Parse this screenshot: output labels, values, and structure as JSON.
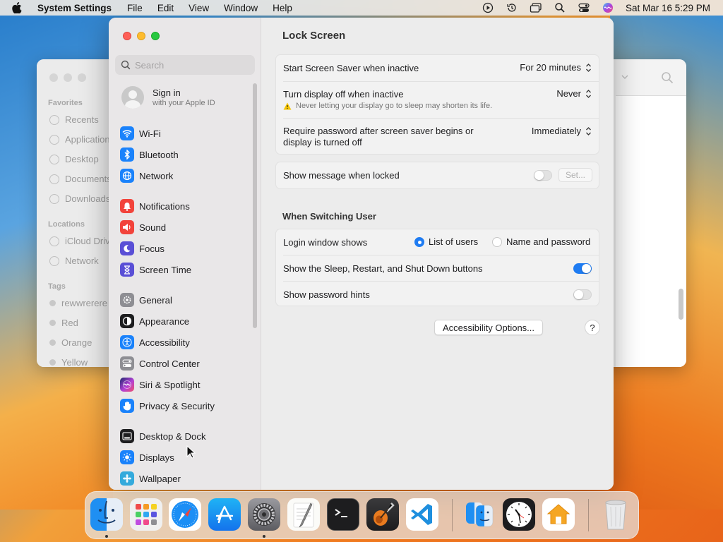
{
  "menubar": {
    "app_name": "System Settings",
    "items": [
      "File",
      "Edit",
      "View",
      "Window",
      "Help"
    ],
    "clock": "Sat Mar 16  5:29 PM"
  },
  "finder_bg": {
    "sections": [
      "Favorites",
      "Locations",
      "Tags"
    ],
    "favorites": [
      "Recents",
      "Applications",
      "Desktop",
      "Documents",
      "Downloads"
    ],
    "locations": [
      "iCloud Drive",
      "Network"
    ],
    "tags": [
      "rewwrerere",
      "Red",
      "Orange",
      "Yellow"
    ]
  },
  "sidebar": {
    "search_placeholder": "Search",
    "signin_title": "Sign in",
    "signin_sub": "with your Apple ID",
    "items": [
      {
        "label": "Wi-Fi",
        "icon": "wifi-icon",
        "color": "#1a82fb"
      },
      {
        "label": "Bluetooth",
        "icon": "bluetooth-icon",
        "color": "#1a82fb"
      },
      {
        "label": "Network",
        "icon": "globe-icon",
        "color": "#1a82fb"
      },
      {
        "label": "Notifications",
        "icon": "bell-icon",
        "color": "#f2433b"
      },
      {
        "label": "Sound",
        "icon": "speaker-icon",
        "color": "#f2433b"
      },
      {
        "label": "Focus",
        "icon": "moon-icon",
        "color": "#5a4fd6"
      },
      {
        "label": "Screen Time",
        "icon": "hourglass-icon",
        "color": "#5a4fd6"
      },
      {
        "label": "General",
        "icon": "gear-icon",
        "color": "#8e8e93"
      },
      {
        "label": "Appearance",
        "icon": "appearance-icon",
        "color": "#1d1d1f"
      },
      {
        "label": "Accessibility",
        "icon": "accessibility-icon",
        "color": "#1a82fb"
      },
      {
        "label": "Control Center",
        "icon": "control-center-icon",
        "color": "#8e8e93"
      },
      {
        "label": "Siri & Spotlight",
        "icon": "siri-icon",
        "color": "#b340d6"
      },
      {
        "label": "Privacy & Security",
        "icon": "hand-icon",
        "color": "#1a82fb"
      },
      {
        "label": "Desktop & Dock",
        "icon": "dock-icon",
        "color": "#1d1d1f"
      },
      {
        "label": "Displays",
        "icon": "sun-icon",
        "color": "#1a82fb"
      },
      {
        "label": "Wallpaper",
        "icon": "wallpaper-icon",
        "color": "#34aadc"
      }
    ]
  },
  "main": {
    "title": "Lock Screen",
    "screensaver_label": "Start Screen Saver when inactive",
    "screensaver_value": "For 20 minutes",
    "display_off_label": "Turn display off when inactive",
    "display_off_value": "Never",
    "display_off_warning": "Never letting your display go to sleep may shorten its life.",
    "require_pw_label_1": "Require password after screen saver begins or",
    "require_pw_label_2": "display is turned off",
    "require_pw_value": "Immediately",
    "show_message_label": "Show message when locked",
    "show_message_on": false,
    "set_button": "Set...",
    "switching_header": "When Switching User",
    "login_window_label": "Login window shows",
    "login_options": [
      "List of users",
      "Name and password"
    ],
    "login_selected": "List of users",
    "sleep_buttons_label": "Show the Sleep, Restart, and Shut Down buttons",
    "sleep_buttons_on": true,
    "password_hints_label": "Show password hints",
    "password_hints_on": false,
    "accessibility_button": "Accessibility Options...",
    "help_button": "?"
  },
  "dock": {
    "apps": [
      "Finder",
      "Launchpad",
      "Safari",
      "App Store",
      "System Settings",
      "TextEdit",
      "Terminal",
      "GarageBand",
      "Visual Studio Code",
      "Migration Assistant",
      "Clock",
      "Home",
      "Trash"
    ],
    "running": [
      "Finder",
      "System Settings"
    ]
  },
  "colors": {
    "accent": "#1f7cf2",
    "close": "#fe5f57",
    "minimize": "#febc2e",
    "zoom": "#28c840"
  }
}
